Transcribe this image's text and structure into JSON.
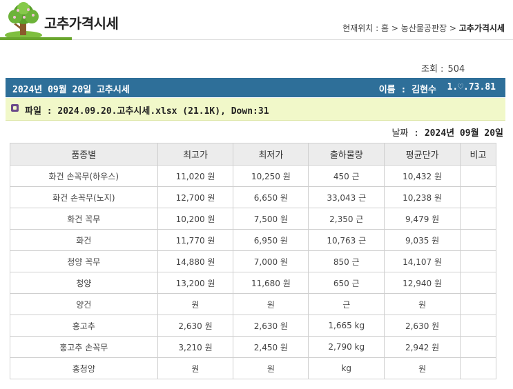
{
  "header": {
    "title": "고추가격시세",
    "location_label": "현재위치 :",
    "breadcrumb": [
      "홈",
      "농산물공판장",
      "고추가격시세"
    ],
    "accent_color": "#6aa62f"
  },
  "views": {
    "label": "조회 :",
    "value": "504"
  },
  "post": {
    "title": "2024년 09월 20일 고추시세",
    "author_label": "이름 :",
    "author": "김현수",
    "ip": "1.♡.73.81",
    "bar_color": "#2e6f99"
  },
  "file": {
    "text": "파일 : 2024.09.20.고추시세.xlsx (21.1K), Down:31"
  },
  "date": {
    "label": "날짜 :",
    "value": "2024년 09월 20일"
  },
  "table": {
    "headers": [
      "품종별",
      "최고가",
      "최저가",
      "출하물량",
      "평균단가",
      "비고"
    ],
    "rows": [
      [
        "화건 손꼭무(하우스)",
        "11,020 원",
        "10,250 원",
        "450 근",
        "10,432 원",
        ""
      ],
      [
        "화건 손꼭무(노지)",
        "12,700 원",
        "6,650 원",
        "33,043 근",
        "10,238 원",
        ""
      ],
      [
        "화건 꼭무",
        "10,200 원",
        "7,500 원",
        "2,350 근",
        "9,479 원",
        ""
      ],
      [
        "화건",
        "11,770 원",
        "6,950 원",
        "10,763 근",
        "9,035 원",
        ""
      ],
      [
        "청양 꼭무",
        "14,880 원",
        "7,000 원",
        "850 근",
        "14,107 원",
        ""
      ],
      [
        "청양",
        "13,200 원",
        "11,680 원",
        "650 근",
        "12,940 원",
        ""
      ],
      [
        "양건",
        "원",
        "원",
        "근",
        "원",
        ""
      ],
      [
        "홍고추",
        "2,630 원",
        "2,630 원",
        "1,665 kg",
        "2,630 원",
        ""
      ],
      [
        "홍고추 손꼭무",
        "3,210 원",
        "2,450 원",
        "2,790 kg",
        "2,942 원",
        ""
      ],
      [
        "홍청양",
        "원",
        "원",
        "kg",
        "원",
        ""
      ]
    ]
  }
}
